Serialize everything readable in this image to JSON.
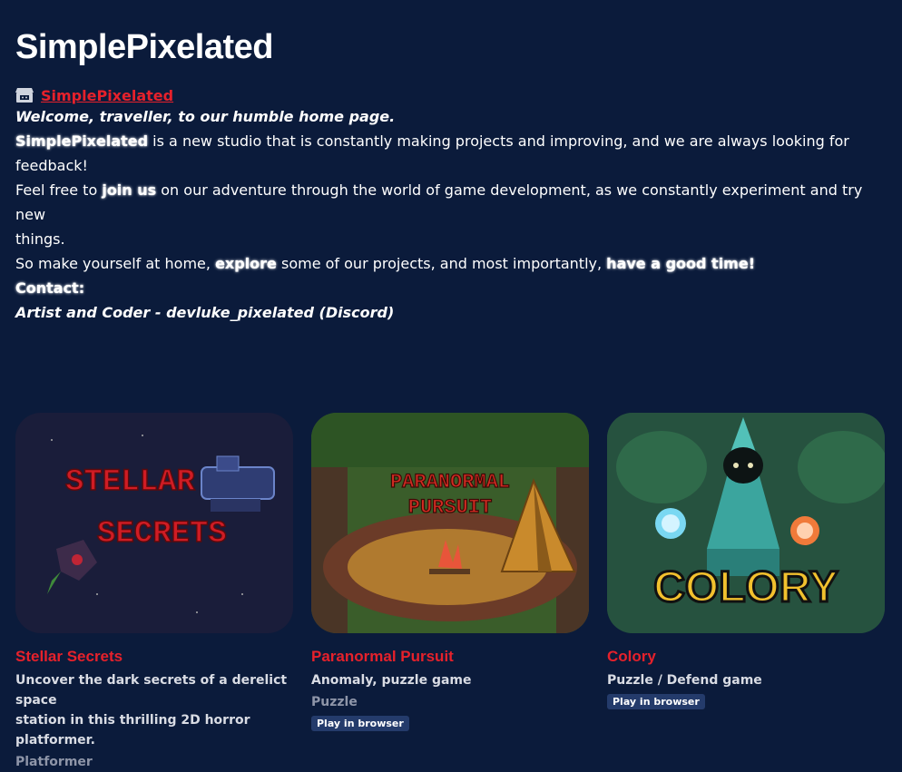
{
  "page": {
    "title": "SimplePixelated",
    "itch_link": "SimplePixelated",
    "welcome": "Welcome, traveller, to our humble home page.",
    "p1": {
      "strong": "SimplePixelated",
      "rest": " is a new studio that is constantly making projects and improving, and we are always looking for feedback!"
    },
    "p2": {
      "before": "Feel free to ",
      "strong": "join us",
      "after": " on our adventure through the world of game development, as we constantly experiment and try new",
      "after2": "things."
    },
    "p3": {
      "before": "So make yourself at home, ",
      "strong1": "explore",
      "middle": " some of our projects, and most importantly, ",
      "strong2": "have a good time!"
    },
    "contact_label": "Contact:",
    "artist_line": "Artist and Coder - devluke_pixelated (Discord)"
  },
  "games": [
    {
      "title": "Stellar Secrets",
      "description_line1": "Uncover the dark secrets of a derelict space",
      "description_line2": "station in this thrilling 2D horror platformer.",
      "genre": "Platformer",
      "thumb_text1": "STELLAR",
      "thumb_text2": "SECRETS"
    },
    {
      "title": "Paranormal Pursuit",
      "description_line1": "Anomaly, puzzle game",
      "genre": "Puzzle",
      "badge": "Play in browser",
      "thumb_text1": "PARANORMAL",
      "thumb_text2": "PURSUIT"
    },
    {
      "title": "Colory",
      "description_line1": "Puzzle / Defend game",
      "badge": "Play in browser",
      "thumb_text1": "COLORY"
    }
  ],
  "colors": {
    "background": "#0b1b3b",
    "accent_red": "#e6212b",
    "badge_bg": "#243b6b"
  }
}
